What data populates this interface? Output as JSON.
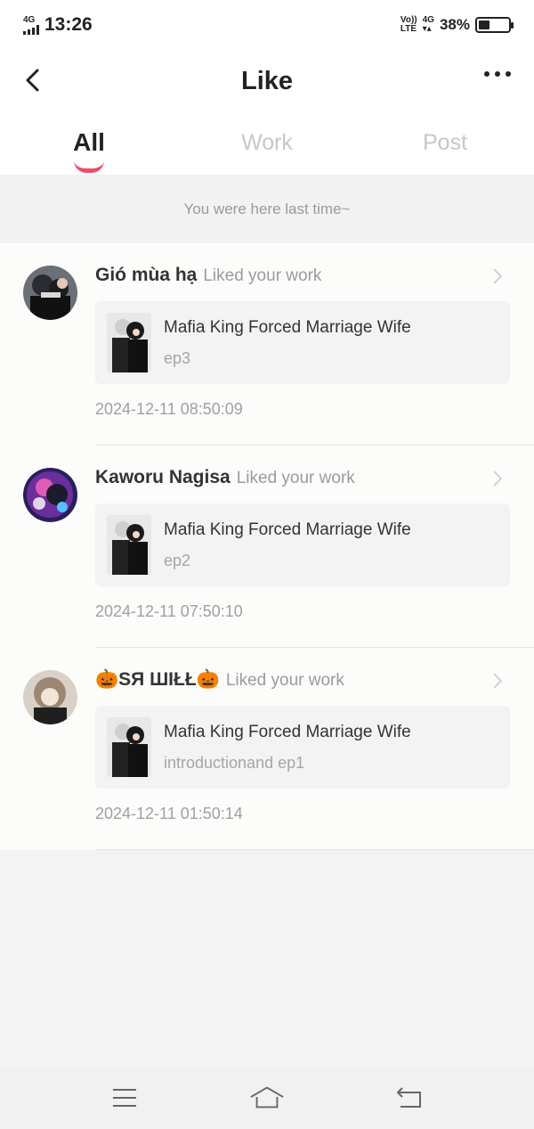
{
  "status_bar": {
    "time": "13:26",
    "network_left": "4G",
    "volte_top": "Vo))",
    "volte_bottom": "LTE",
    "network_right": "4G",
    "battery_percent": "38%",
    "battery_level": 0.38
  },
  "nav": {
    "title": "Like",
    "back_icon": "chevron-left-icon",
    "more_icon": "more-dots-icon"
  },
  "tabs": [
    {
      "label": "All",
      "active": true
    },
    {
      "label": "Work",
      "active": false
    },
    {
      "label": "Post",
      "active": false
    }
  ],
  "notice": "You were here last time~",
  "items": [
    {
      "username": "Gió mùa hạ",
      "action": "Liked your work",
      "work_title": "Mafia King Forced Marriage Wife",
      "episode": "ep3",
      "timestamp": "2024-12-11 08:50:09"
    },
    {
      "username": "Kaworu Nagisa",
      "action": "Liked your work",
      "work_title": "Mafia King Forced Marriage Wife",
      "episode": "ep2",
      "timestamp": "2024-12-11 07:50:10"
    },
    {
      "username": "🎃SЯ ШIŁŁ🎃",
      "action": "Liked your work",
      "work_title": "Mafia King Forced Marriage Wife",
      "episode": "introductionand ep1",
      "timestamp": "2024-12-11 01:50:14"
    }
  ],
  "colors": {
    "accent": "#ee4d6a",
    "muted_text": "#9b9b9b",
    "background": "#f3f3f3"
  }
}
